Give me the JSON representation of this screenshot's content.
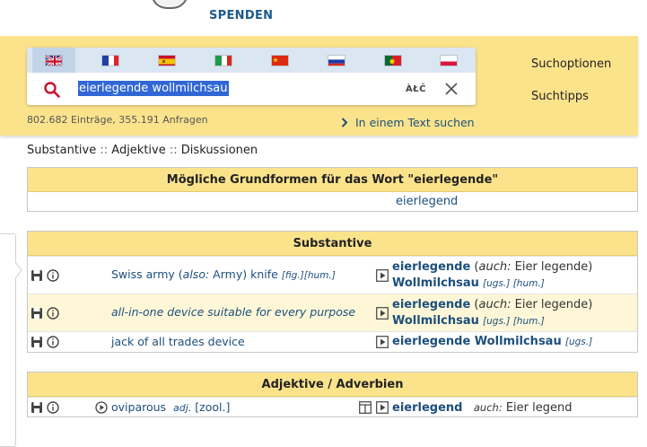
{
  "header": {
    "donate_label": "SPENDEN"
  },
  "search": {
    "languages": [
      {
        "code": "en",
        "name": "English",
        "icon": "flag-uk"
      },
      {
        "code": "fr",
        "name": "French",
        "icon": "flag-fr"
      },
      {
        "code": "es",
        "name": "Spanish",
        "icon": "flag-es"
      },
      {
        "code": "it",
        "name": "Italian",
        "icon": "flag-it"
      },
      {
        "code": "zh",
        "name": "Chinese",
        "icon": "flag-cn"
      },
      {
        "code": "ru",
        "name": "Russian",
        "icon": "flag-ru"
      },
      {
        "code": "pt",
        "name": "Portuguese",
        "icon": "flag-pt"
      },
      {
        "code": "pl",
        "name": "Polish",
        "icon": "flag-pl"
      }
    ],
    "query": "eierlegende wollmilchsau",
    "special_chars_label": "ÀŁČ",
    "stats": "802.682 Einträge, 355.191 Anfragen",
    "text_search_label": "In einem Text suchen"
  },
  "side_links": {
    "options": "Suchoptionen",
    "tips": "Suchtipps"
  },
  "result_nav": {
    "nouns": "Substantive",
    "sep1": "::",
    "adjectives": "Adjektive",
    "sep2": "::",
    "discussions": "Diskussionen"
  },
  "base_forms": {
    "title": "Mögliche Grundformen für das Wort \"eierlegende\"",
    "value": "eierlegend"
  },
  "nouns": {
    "title": "Substantive",
    "rows": [
      {
        "en_main": "Swiss army",
        "en_also_paren_open": "(",
        "en_also_label": "also:",
        "en_also_value": "Army)",
        "en_tail": "knife",
        "en_meta": "[fig.][hum.]",
        "de_main": "eierlegende",
        "de_aux_open": "(",
        "de_aux_label": "auch:",
        "de_aux_value": "Eier legende)",
        "de_second": "Wollmilchsau",
        "de_meta": "[ugs.] [hum.]"
      },
      {
        "en_main": "all-in-one device suitable for every purpose",
        "de_main": "eierlegende",
        "de_aux_open": "(",
        "de_aux_label": "auch:",
        "de_aux_value": "Eier legende)",
        "de_second": "Wollmilchsau",
        "de_meta": "[ugs.] [hum.]"
      },
      {
        "en_main": "jack of all trades device",
        "de_main": "eierlegende Wollmilchsau",
        "de_meta": "[ugs.]"
      }
    ]
  },
  "adjectives": {
    "title": "Adjektive / Adverbien",
    "rows": [
      {
        "en_main": "oviparous",
        "en_pos": "adj.",
        "en_field": "[zool.]",
        "de_main": "eierlegend",
        "de_aux_label": "auch:",
        "de_aux_value": "Eier legend"
      }
    ]
  },
  "colors": {
    "brand_yellow": "#fbe38c",
    "link_blue": "#1d4f7c",
    "selection_blue": "#3067d4",
    "search_red": "#c8102e"
  }
}
